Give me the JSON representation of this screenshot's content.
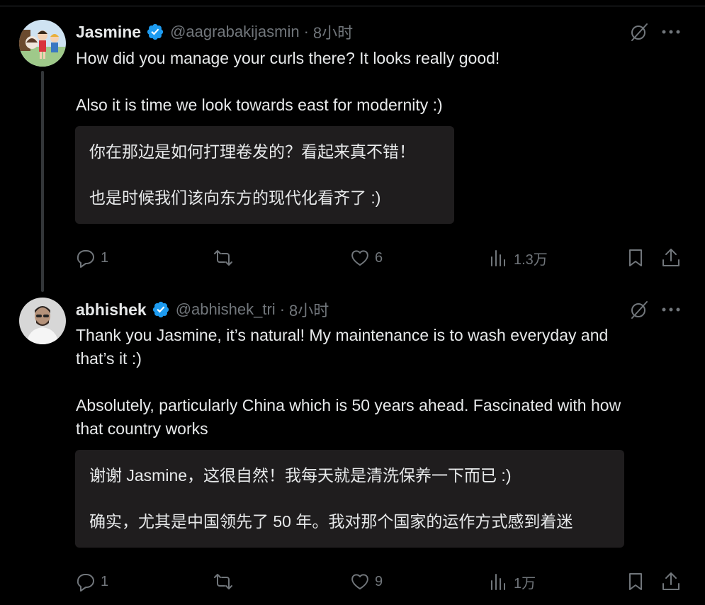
{
  "tweets": [
    {
      "name": "Jasmine",
      "handle": "@aagrabakijasmin",
      "separator": "·",
      "time": "8小时",
      "text": [
        "How did you manage your curls there? It looks really good!",
        "Also it is time we look towards east for modernity :)"
      ],
      "translation": [
        "你在那边是如何打理卷发的？看起来真不错！",
        "也是时候我们该向东方的现代化看齐了 :)"
      ],
      "replies": "1",
      "retweets": "",
      "likes": "6",
      "views": "1.3万"
    },
    {
      "name": "abhishek",
      "handle": "@abhishek_tri",
      "separator": "·",
      "time": "8小时",
      "text": [
        "Thank you Jasmine, it’s natural! My maintenance is to wash everyday and",
        "that’s it :)",
        "Absolutely, particularly China which is 50 years ahead. Fascinated with how",
        "that country works"
      ],
      "translation": [
        "谢谢 Jasmine，这很自然！我每天就是清洗保养一下而已 :)",
        "确实，尤其是中国领先了 50 年。我对那个国家的运作方式感到着迷"
      ],
      "replies": "1",
      "retweets": "",
      "likes": "9",
      "views": "1万"
    }
  ],
  "colors": {
    "background": "#000000",
    "text": "#e7e9ea",
    "secondary": "#71767b",
    "verified": "#1d9bf0",
    "translation_bg": "#1f1d1e"
  }
}
